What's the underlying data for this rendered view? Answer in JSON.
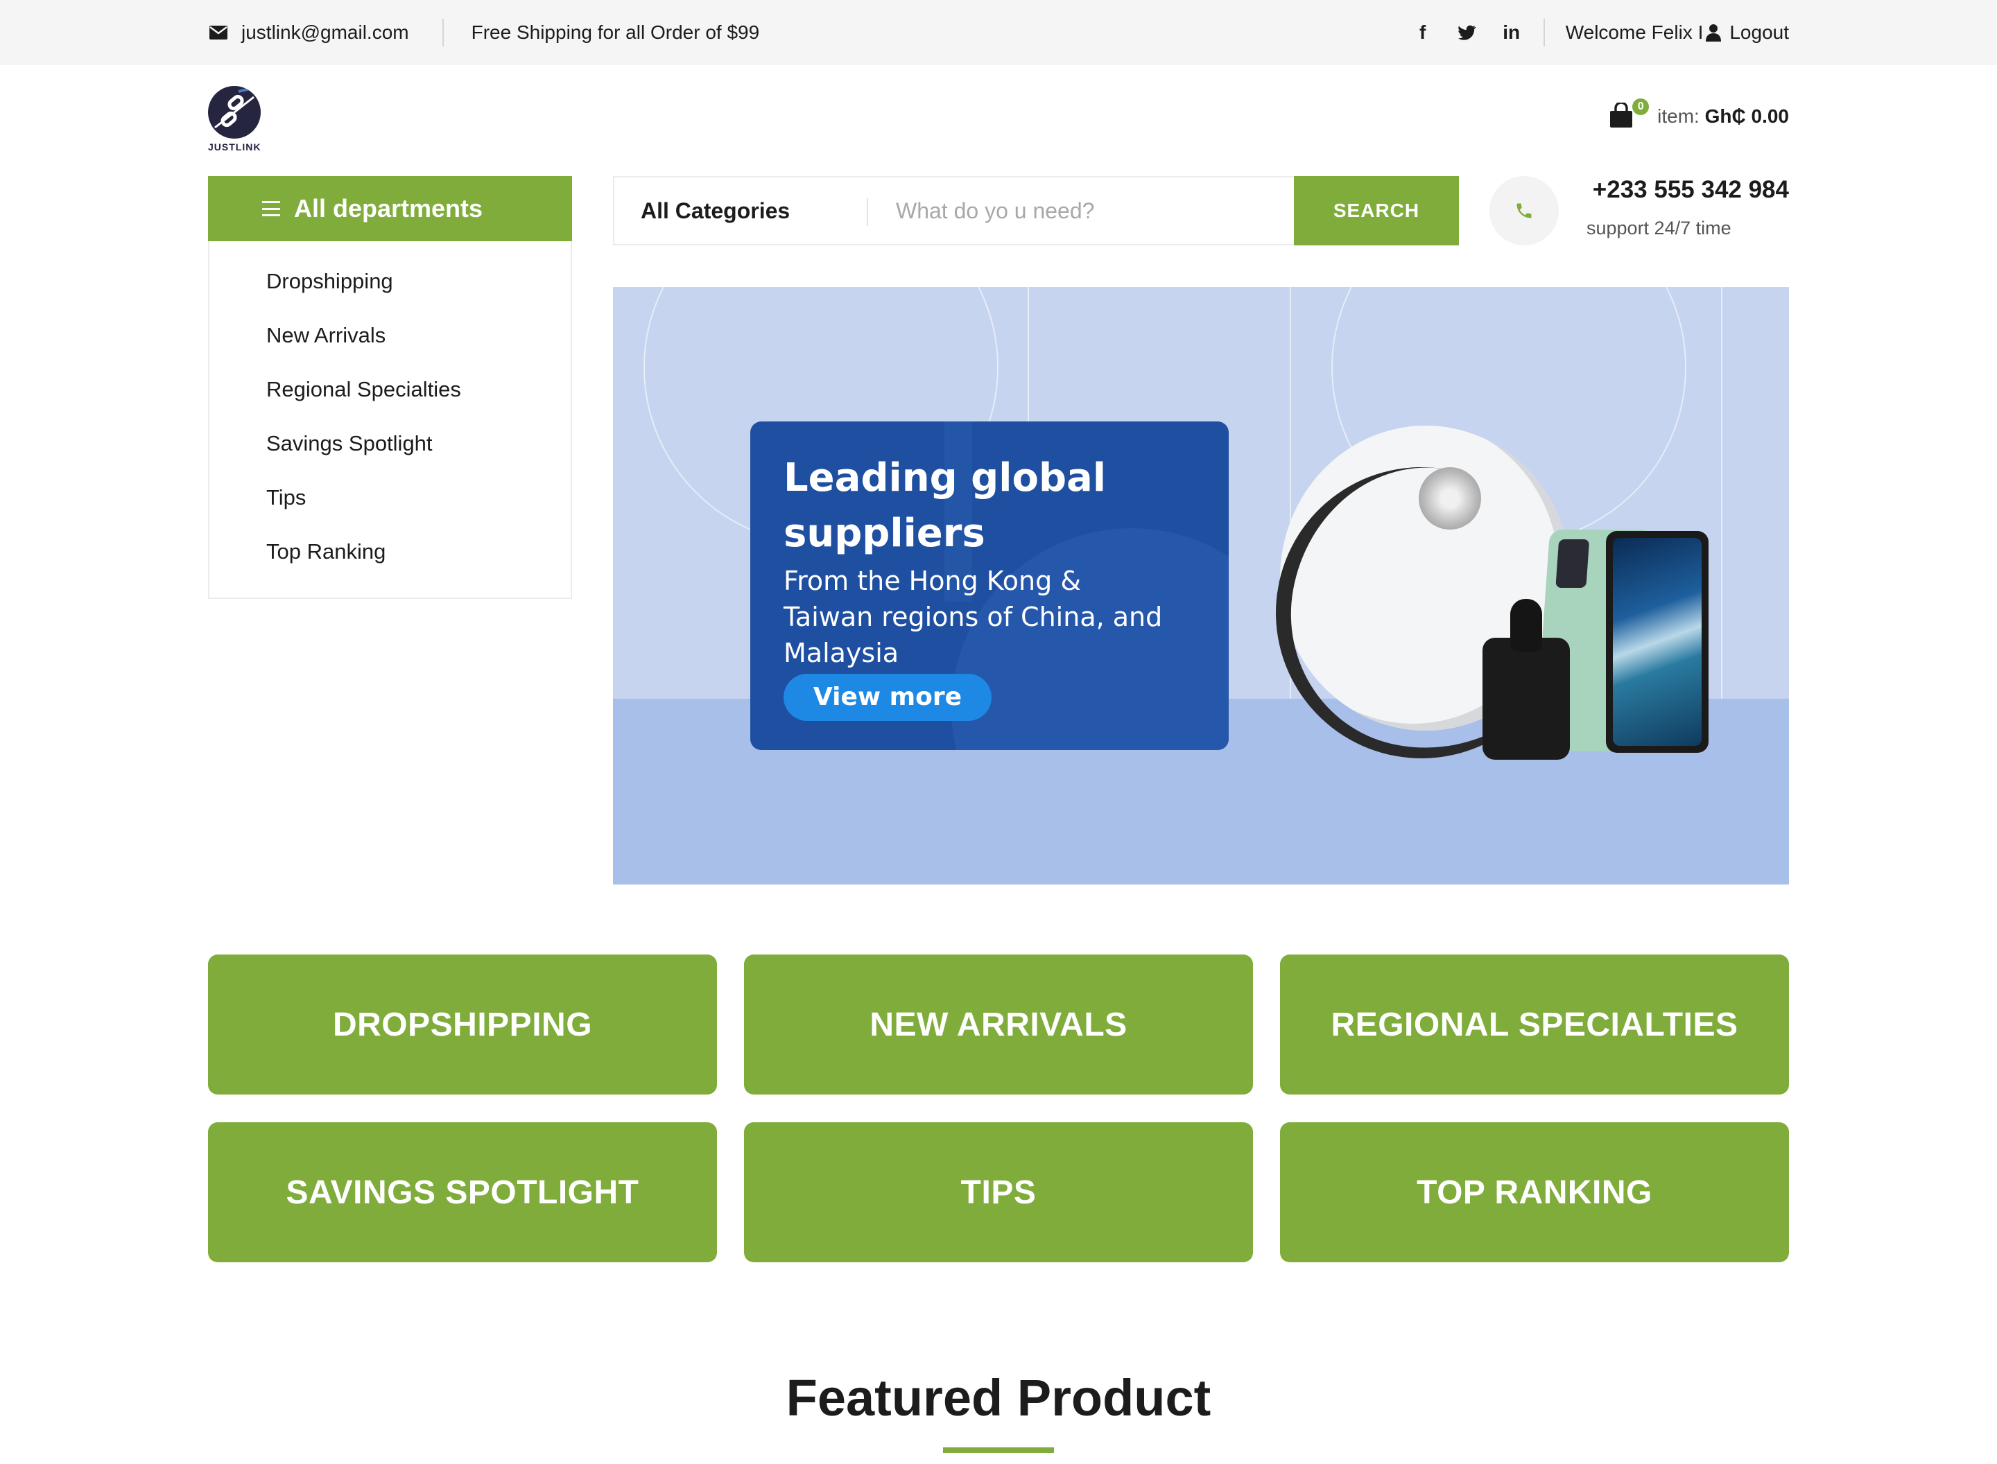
{
  "topbar": {
    "email": "justlink@gmail.com",
    "shipping_notice": "Free Shipping for all Order of $99",
    "social": [
      "facebook-icon",
      "twitter-icon",
      "linkedin-icon"
    ],
    "social_glyphs": {
      "facebook": "f",
      "twitter": "t",
      "linkedin": "in"
    },
    "welcome": "Welcome Felix I",
    "logout": "Logout"
  },
  "header": {
    "logo_text": "JUSTLINK",
    "cart_count": "0",
    "cart_label": "item:",
    "cart_total": "Gh₵ 0.00"
  },
  "departments": {
    "title": "All departments",
    "items": [
      {
        "label": "Dropshipping"
      },
      {
        "label": "New Arrivals"
      },
      {
        "label": "Regional Specialties"
      },
      {
        "label": "Savings Spotlight"
      },
      {
        "label": "Tips"
      },
      {
        "label": "Top Ranking"
      }
    ]
  },
  "search": {
    "category": "All Categories",
    "placeholder": "What do yo u need?",
    "button": "SEARCH"
  },
  "contact": {
    "phone": "+233 555 342 984",
    "support": "support 24/7 time"
  },
  "hero": {
    "title_line1": "Leading global",
    "title_line2": "suppliers",
    "subtitle_line1": "From the Hong Kong &",
    "subtitle_line2": "Taiwan regions of China, and",
    "subtitle_line3": "Malaysia",
    "button": "View more"
  },
  "tiles": [
    {
      "label": "DROPSHIPPING"
    },
    {
      "label": "NEW ARRIVALS"
    },
    {
      "label": "REGIONAL SPECIALTIES"
    },
    {
      "label": "SAVINGS SPOTLIGHT"
    },
    {
      "label": "TIPS"
    },
    {
      "label": "TOP RANKING"
    }
  ],
  "featured": {
    "title": "Featured Product"
  },
  "colors": {
    "accent": "#7fac3b",
    "topbar_bg": "#f5f5f5",
    "hero_bg": "#c7d4f0",
    "hero_card": "#1f4fa0"
  }
}
